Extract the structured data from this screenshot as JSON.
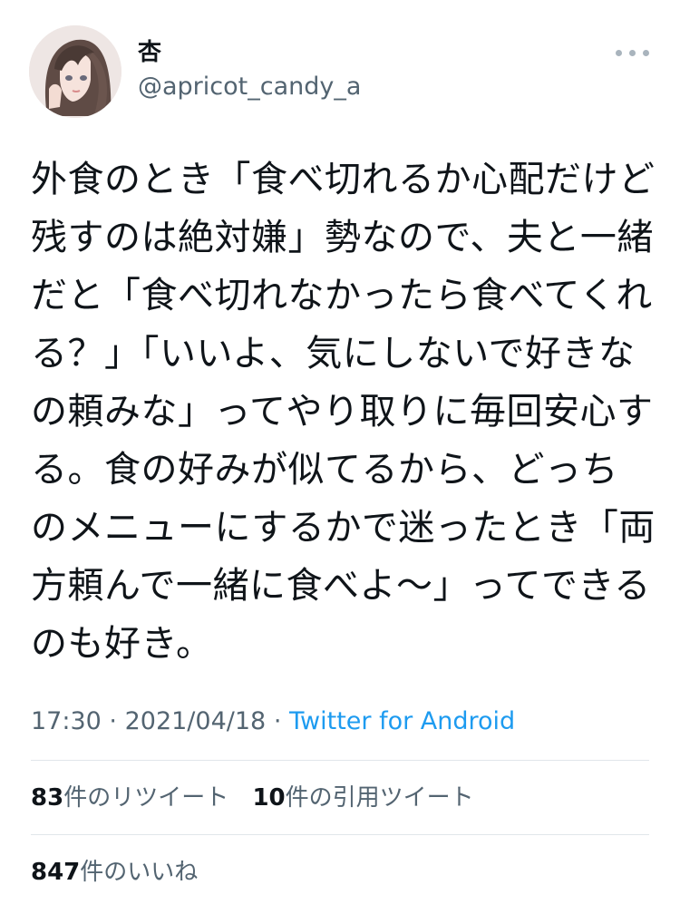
{
  "user": {
    "display_name": "杏",
    "handle": "@apricot_candy_a"
  },
  "tweet": {
    "lines": [
      "外食のとき「食べ切れるか心配だけど",
      "残すのは絶対嫌」勢なので、夫と一緒",
      "だと「食べ切れなかったら食べてくれ",
      "る？」「いいよ、気にしないで好きな",
      "の頼みな」ってやり取りに毎回安心す",
      "る。食の好みが似てるから、どっち",
      "のメニューにするかで迷ったとき「両",
      "方頼んで一緒に食べよ〜」ってできる",
      "のも好き。"
    ]
  },
  "meta": {
    "time": "17:30",
    "separator": "·",
    "date": "2021/04/18",
    "source": "Twitter for Android"
  },
  "stats": {
    "retweets_count": "83",
    "retweets_label": "件のリツイート",
    "quotes_count": "10",
    "quotes_label": "件の引用ツイート",
    "likes_count": "847",
    "likes_label": "件のいいね"
  },
  "icons": {
    "more": "more-dots-icon"
  },
  "colors": {
    "text": "#0f1419",
    "secondary": "#536471",
    "link": "#1d9bf0",
    "divider": "#e1e6ea"
  }
}
